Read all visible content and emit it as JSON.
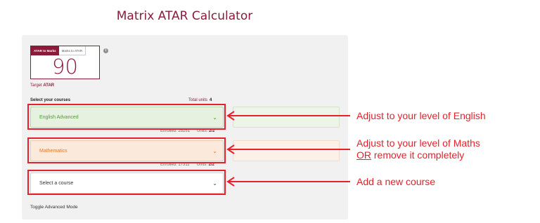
{
  "page": {
    "title": "Matrix ATAR Calculator"
  },
  "atar": {
    "tabs": [
      {
        "label": "ATAR to Marks",
        "active": true
      },
      {
        "label": "Marks to ATAR",
        "active": false
      }
    ],
    "value": "90",
    "info_icon": "info-icon",
    "target_prefix": "Target ",
    "target_strong": "ATAR"
  },
  "courses": {
    "heading": "Select your courses",
    "total_units_label": "Total units",
    "total_units_value": "4",
    "items": [
      {
        "name": "English Advanced",
        "enrolled": "Enrolled: 25251",
        "units_label": "Units:",
        "units_value": "2/2",
        "color": "#4f9a35"
      },
      {
        "name": "Mathematics",
        "enrolled": "Enrolled: 17311",
        "units_label": "Units:",
        "units_value": "2/2",
        "color": "#e0762a"
      }
    ],
    "new_course_placeholder": "Select a course",
    "toggle_advanced": "Toggle Advanced Mode"
  },
  "callouts": {
    "english": "Adjust to your level of English",
    "maths_line1": "Adjust to your level of Maths",
    "maths_or": "OR",
    "maths_line2_rest": " remove it completely",
    "new_course": "Add a new course",
    "color": "#e8202a"
  }
}
